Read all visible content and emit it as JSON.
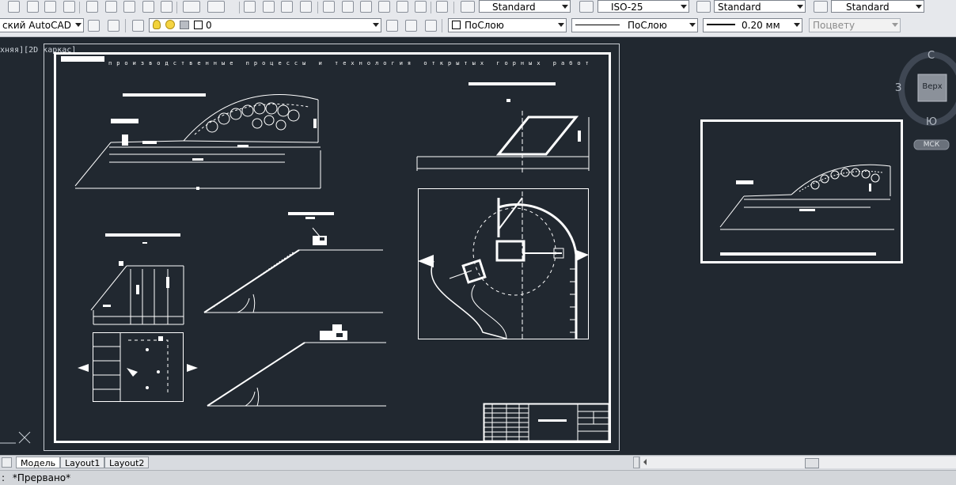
{
  "colors": {
    "viewport_bg": "#212830",
    "drawing_lines": "#ffffff",
    "toolbar_bg": "#e6e8ec"
  },
  "top_toolbar": {
    "text_style_value": "Standard",
    "dim_style_value": "ISO-25",
    "table_style_value": "Standard",
    "mleader_style_value": "Standard"
  },
  "layer_toolbar": {
    "workspace_value": "ский AutoCAD",
    "layer_value": "0",
    "color_value": "ПоСлою",
    "linetype_value": "ПоСлою",
    "lineweight_value": "0.20 мм",
    "plotstyle_value": "Поцвету"
  },
  "viewport": {
    "label": "хняя][2D каркас]",
    "drawing_title": "производственные процессы и технология открытых горных работ"
  },
  "viewcube": {
    "north": "С",
    "south": "Ю",
    "west": "З",
    "face": "Верх",
    "ucs": "МСК"
  },
  "tabs": [
    {
      "label": "Модель",
      "active": true
    },
    {
      "label": "Layout1",
      "active": false
    },
    {
      "label": "Layout2",
      "active": false
    }
  ],
  "command_line": {
    "prompt": ":",
    "text": "*Прервано*"
  }
}
